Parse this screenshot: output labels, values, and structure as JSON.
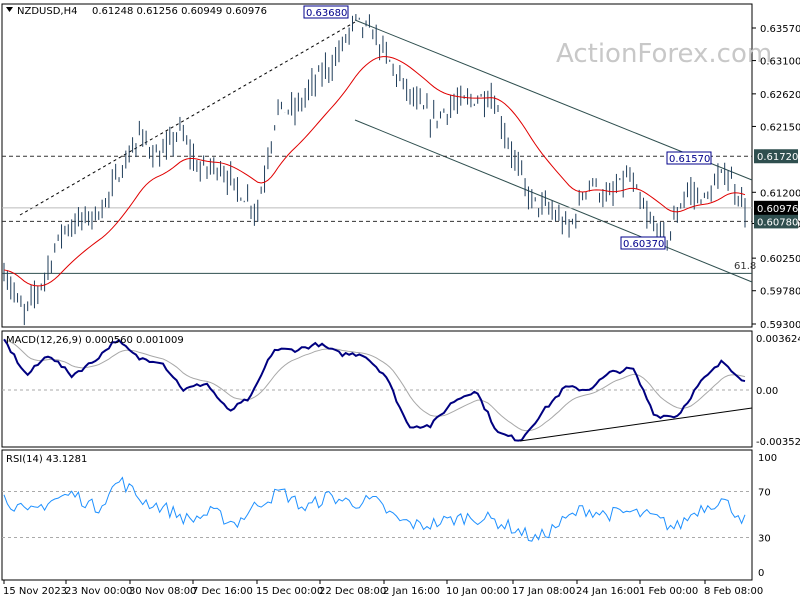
{
  "header": {
    "symbol": "NZDUSD,H4",
    "ohlc": "0.61248 0.61256 0.60949 0.60976"
  },
  "watermark": "ActionForex.com",
  "colors": {
    "bars": "#1f3d5a",
    "ma": "#e00000",
    "macd": "#000080",
    "signal": "#a8a8a8",
    "rsi": "#1e90ff",
    "trend": "#2f4f4f",
    "label_bg": "#2f4f4f",
    "current_bg": "#000000",
    "annot": "#00008b"
  },
  "chart_data": [
    {
      "type": "line",
      "title": "NZDUSD,H4",
      "ylim": [
        0.5915,
        0.6385
      ],
      "yticks": [
        "0.63570",
        "0.63100",
        "0.62620",
        "0.62150",
        "0.61200",
        "0.60750",
        "0.60250",
        "0.59780",
        "0.59300"
      ],
      "ytick_values": [
        0.6357,
        0.631,
        0.6262,
        0.6215,
        0.612,
        0.6075,
        0.6025,
        0.5978,
        0.593
      ],
      "price_points": [
        0.6008,
        0.5943,
        0.5993,
        0.6066,
        0.608,
        0.6094,
        0.6152,
        0.6203,
        0.6167,
        0.621,
        0.6152,
        0.6159,
        0.6123,
        0.6094,
        0.6239,
        0.6239,
        0.6282,
        0.6311,
        0.6368,
        0.6347,
        0.6296,
        0.6253,
        0.6224,
        0.6246,
        0.6253,
        0.626,
        0.6181,
        0.6109,
        0.6094,
        0.6066,
        0.6138,
        0.6109,
        0.6145,
        0.608,
        0.6051,
        0.6123,
        0.6109,
        0.6152,
        0.6098
      ],
      "annotations": [
        {
          "text": "0.63680",
          "value": 0.6368
        },
        {
          "text": "0.61570",
          "value": 0.6157
        },
        {
          "text": "0.60370",
          "value": 0.6037
        },
        {
          "text": "61.8",
          "value": 0.6003
        }
      ],
      "hlines": [
        {
          "label": "0.61720",
          "value": 0.6172,
          "style": "dashed"
        },
        {
          "label": "0.60780",
          "value": 0.6078,
          "style": "dashed"
        },
        {
          "label": "0.60976",
          "value": 0.60976,
          "style": "current"
        },
        {
          "label": "",
          "value": 0.6003,
          "style": "solid"
        }
      ]
    },
    {
      "type": "line",
      "title": "MACD(12,26,9) 0.000560 0.001009",
      "ylim": [
        -0.003525,
        0.003624
      ],
      "yticks": [
        "0.003624",
        "0.00",
        "-0.003525"
      ],
      "macd_points": [
        0.0035,
        0.001,
        0.0025,
        0.001,
        0.002,
        0.0035,
        0.0022,
        0.002,
        0.0,
        0.0005,
        -0.0015,
        -0.0005,
        0.0028,
        0.0028,
        0.0032,
        0.0025,
        0.0025,
        0.001,
        -0.0025,
        -0.0025,
        -0.0008,
        0.0,
        -0.003,
        -0.0035,
        -0.0015,
        0.0002,
        0.0,
        0.0012,
        0.0015,
        -0.0018,
        -0.0018,
        0.0005,
        0.002,
        0.0006
      ]
    },
    {
      "type": "line",
      "title": "RSI(14) 43.1281",
      "ylim": [
        0,
        100
      ],
      "yticks": [
        "100",
        "70",
        "30",
        "0"
      ],
      "ytick_values": [
        100,
        70,
        30,
        0
      ],
      "rsi_points": [
        65,
        50,
        62,
        68,
        55,
        80,
        62,
        55,
        45,
        52,
        42,
        60,
        70,
        55,
        66,
        60,
        62,
        45,
        40,
        44,
        48,
        46,
        38,
        28,
        42,
        55,
        50,
        52,
        48,
        38,
        55,
        63,
        45
      ]
    }
  ],
  "xaxis": {
    "labels": [
      "15 Nov 2023",
      "23 Nov 00:00",
      "30 Nov 08:00",
      "7 Dec 16:00",
      "15 Dec 00:00",
      "22 Dec 08:00",
      "2 Jan 16:00",
      "10 Jan 00:00",
      "17 Jan 08:00",
      "24 Jan 16:00",
      "1 Feb 00:00",
      "8 Feb 08:00"
    ]
  }
}
